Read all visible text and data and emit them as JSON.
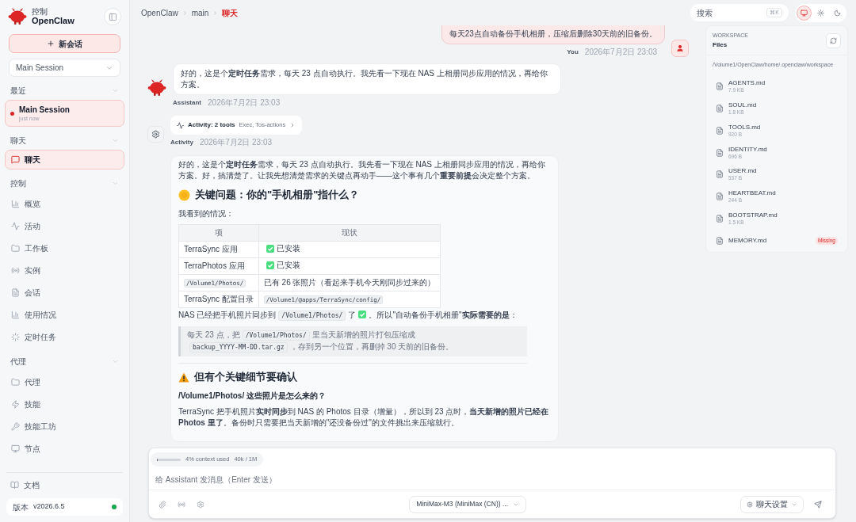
{
  "sidebar": {
    "brand_caption": "控制",
    "brand_name": "OpenClaw",
    "new_chat": "新会话",
    "session_select": "Main Session",
    "sections": [
      {
        "title": "最近",
        "expanded": true,
        "items": [
          {
            "kind": "session",
            "label": "Main Session",
            "sub": "just now",
            "selected": true
          }
        ]
      },
      {
        "title": "聊天",
        "expanded": true,
        "items": [
          {
            "kind": "nav",
            "label": "聊天",
            "selected": true
          }
        ]
      },
      {
        "title": "控制",
        "expanded": true,
        "items": [
          {
            "kind": "nav",
            "label": "概览",
            "selected": false
          },
          {
            "kind": "nav",
            "label": "活动",
            "selected": false
          },
          {
            "kind": "nav",
            "label": "工作板",
            "selected": false
          },
          {
            "kind": "nav",
            "label": "实例",
            "selected": false
          },
          {
            "kind": "nav",
            "label": "会话",
            "selected": false
          },
          {
            "kind": "nav",
            "label": "使用情况",
            "selected": false
          },
          {
            "kind": "nav",
            "label": "定时任务",
            "selected": false
          }
        ]
      },
      {
        "title": "代理",
        "expanded": true,
        "items": [
          {
            "kind": "nav",
            "label": "代理",
            "selected": false
          },
          {
            "kind": "nav",
            "label": "技能",
            "selected": false
          },
          {
            "kind": "nav",
            "label": "技能工坊",
            "selected": false
          },
          {
            "kind": "nav",
            "label": "节点",
            "selected": false
          }
        ]
      }
    ],
    "docs": "文档",
    "version_label": "版本",
    "version": "v2026.6.5",
    "online": true
  },
  "header": {
    "breadcrumb": [
      "OpenClaw",
      "main",
      "聊天"
    ],
    "search": {
      "placeholder": "搜索",
      "shortcut": "⌘K"
    },
    "theme_modes": [
      {
        "selected": true
      },
      {
        "selected": false
      },
      {
        "selected": false
      }
    ]
  },
  "messages": [
    {
      "kind": "user",
      "text": "每天23点自动备份手机相册，压缩后删除30天前的旧备份。",
      "sender": "You",
      "time": "2026年7月2日 23:03"
    },
    {
      "kind": "assistant",
      "text": "好的，这是个**定时任务**需求，每天 23 点自动执行。我先看一下现在 NAS 上相册同步应用的情况，再给你方案。",
      "sender": "Assistant",
      "time": "2026年7月2日 23:03"
    },
    {
      "kind": "activity",
      "title": "Activity: 2 tools",
      "detail": "Exec, Tos-actions",
      "sender": "Activity",
      "time": "2026年7月2日 23:03"
    },
    {
      "kind": "rich",
      "blocks": [
        {
          "kind": "paragraph",
          "parts": [
            {
              "kind": "text",
              "text": "好的，这是个**定时任务**需求，每天 23 点自动执行。我先看一下现在 NAS 上相册同步应用的情况，再给你方案。好，搞清楚了。让我先想清楚需求的关键点再动手——这个事有几个**重要前提**会决定整个方案。"
            }
          ]
        },
        {
          "kind": "heading",
          "text": "关键问题：你的\"手机相册\"指什么？"
        },
        {
          "kind": "paragraph",
          "parts": [
            {
              "kind": "text",
              "text": "我看到的情况："
            }
          ]
        },
        {
          "kind": "table",
          "columns": [
            "项",
            "现状"
          ],
          "rows": [
            [
              {
                "kind": "text",
                "text": "TerraSync 应用"
              },
              {
                "kind": "done",
                "text": "已安装"
              }
            ],
            [
              {
                "kind": "text",
                "text": "TerraPhotos 应用"
              },
              {
                "kind": "done",
                "text": "已安装"
              }
            ],
            [
              {
                "kind": "code",
                "text": "/Volume1/Photos/"
              },
              {
                "kind": "text",
                "text": "已有 26 张照片（看起来手机今天刚同步过来的）"
              }
            ],
            [
              {
                "kind": "text",
                "text": "TerraSync 配置目录"
              },
              {
                "kind": "code",
                "text": "/Volume1/@apps/TerraSync/config/"
              }
            ]
          ]
        },
        {
          "kind": "paragraph",
          "parts": [
            {
              "kind": "text",
              "text": "NAS 已经把手机照片同步到"
            },
            {
              "kind": "code",
              "text": "/Volume1/Photos/"
            },
            {
              "kind": "text",
              "text": "了"
            },
            {
              "kind": "check"
            },
            {
              "kind": "text",
              "text": "。所以\"自动备份手机相册\"**实际需要的是**："
            }
          ]
        },
        {
          "kind": "quote",
          "parts": [
            {
              "kind": "text",
              "text": "每天 23 点，把"
            },
            {
              "kind": "code",
              "text": "/Volume1/Photos/"
            },
            {
              "kind": "text",
              "text": "里当天新增的照片打包压缩成"
            },
            {
              "kind": "code",
              "text": "backup_YYYY-MM-DD.tar.gz"
            },
            {
              "kind": "text",
              "text": "，存到另一个位置，再删掉 30 天前的旧备份。"
            }
          ]
        },
        {
          "kind": "divider"
        },
        {
          "kind": "heading",
          "text": "但有个关键细节要确认"
        },
        {
          "kind": "subheading",
          "text": "/Volume1/Photos/ 这些照片是怎么来的？"
        },
        {
          "kind": "paragraph",
          "parts": [
            {
              "kind": "text",
              "text": "TerraSync 把手机照片**实时同步**到 NAS 的 Photos 目录（增量），所以到 23 点时，**当天新增的照片已经在 Photos 里了**。备份时只需要把当天新增的\"还没备份过\"的文件挑出来压缩就行。"
            }
          ]
        }
      ]
    }
  ],
  "files": {
    "caption": "WORKSPACE",
    "title": "Files",
    "path": "/Volume1/OpenClaw/home/.openclaw/workspace",
    "items": [
      {
        "name": "AGENTS.md",
        "size": "7.9 KB"
      },
      {
        "name": "SOUL.md",
        "size": "1.8 KB"
      },
      {
        "name": "TOOLS.md",
        "size": "920 B"
      },
      {
        "name": "IDENTITY.md",
        "size": "696 B"
      },
      {
        "name": "USER.md",
        "size": "537 B"
      },
      {
        "name": "HEARTBEAT.md",
        "size": "244 B"
      },
      {
        "name": "BOOTSTRAP.md",
        "size": "1.5 KB"
      },
      {
        "name": "MEMORY.md",
        "badge": "Missing"
      }
    ]
  },
  "composer": {
    "context": {
      "label": "4% context used",
      "tokens": "40k / 1M",
      "level": 0.04
    },
    "placeholder": "给 Assistant 发消息（Enter 发送）",
    "model": "MiniMax-M3 (MiniMax (CN)) ...",
    "settings": "聊天设置"
  }
}
